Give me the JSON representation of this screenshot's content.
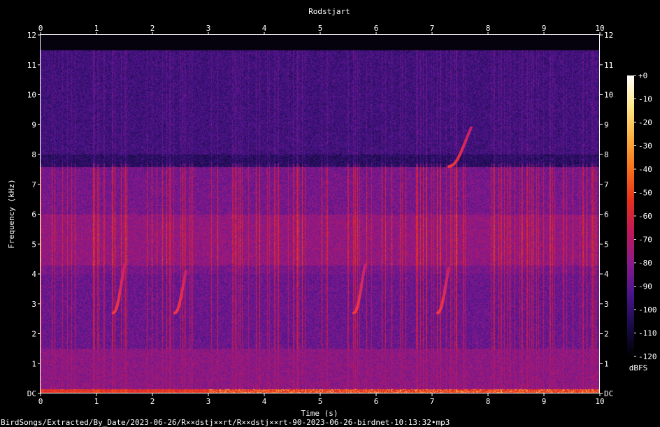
{
  "chart_data": {
    "type": "heatmap",
    "title": "Rodstjart",
    "xlabel": "Time (s)",
    "ylabel": "Frequency (kHz)",
    "xlim": [
      0,
      10
    ],
    "ylim": [
      0,
      12
    ],
    "x_ticks": [
      "0",
      "1",
      "2",
      "3",
      "4",
      "5",
      "6",
      "7",
      "8",
      "9",
      "10"
    ],
    "y_ticks": [
      "DC",
      "1",
      "2",
      "3",
      "4",
      "5",
      "6",
      "7",
      "8",
      "9",
      "10",
      "11",
      "12"
    ],
    "colorbar": {
      "label": "dBFS",
      "range": [
        -120,
        0
      ],
      "ticks": [
        "+0",
        "-10",
        "-20",
        "-30",
        "-40",
        "-50",
        "-60",
        "-70",
        "-80",
        "-90",
        "-100",
        "-110",
        "-120"
      ],
      "colors": [
        "#000000",
        "#1a0b4a",
        "#4a148c",
        "#8a1a8a",
        "#c0185a",
        "#e8301c",
        "#f7701a",
        "#fbb040",
        "#fde887",
        "#ffffff"
      ]
    },
    "calls": [
      {
        "start_s": 1.3,
        "end_s": 1.5,
        "low_khz": 2.7,
        "high_khz": 4.3
      },
      {
        "start_s": 2.4,
        "end_s": 2.6,
        "low_khz": 2.7,
        "high_khz": 4.1
      },
      {
        "start_s": 5.6,
        "end_s": 5.8,
        "low_khz": 2.7,
        "high_khz": 4.3
      },
      {
        "start_s": 7.1,
        "end_s": 7.3,
        "low_khz": 2.7,
        "high_khz": 4.2
      },
      {
        "start_s": 7.3,
        "end_s": 7.7,
        "low_khz": 7.6,
        "high_khz": 8.9
      }
    ]
  },
  "footer": {
    "file_path": "BirdSongs/Extracted/By_Date/2023-06-26/R××dstj××rt/R××dstj××rt-90-2023-06-26-birdnet-10:13:32•mp3"
  }
}
